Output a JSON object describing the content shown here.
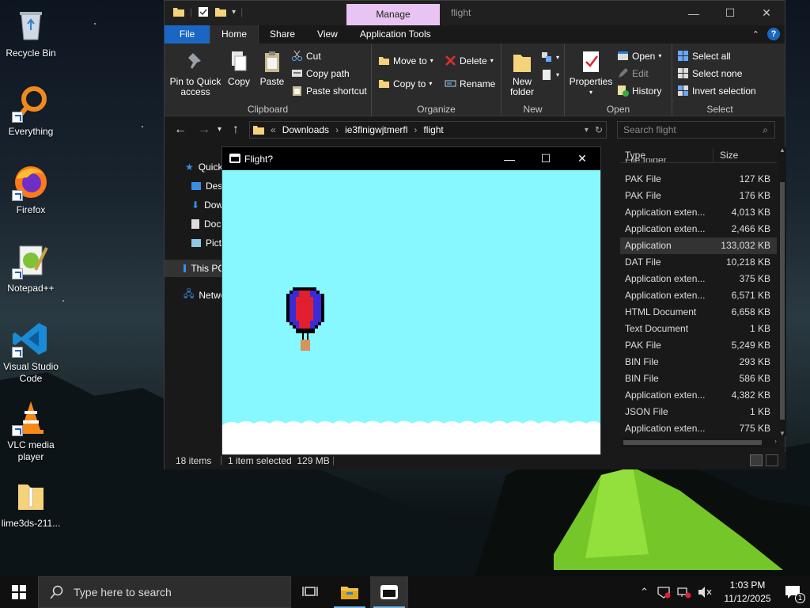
{
  "desktop": {
    "icons": [
      {
        "label": "Recycle Bin"
      },
      {
        "label": "Everything"
      },
      {
        "label": "Firefox"
      },
      {
        "label": "Notepad++"
      },
      {
        "label": "Visual Studio Code"
      },
      {
        "label": "VLC media player"
      },
      {
        "label": "lime3ds-211..."
      }
    ]
  },
  "explorer": {
    "title": "flight",
    "manage_tab": "Manage",
    "ribbon_tabs": [
      "File",
      "Home",
      "Share",
      "View",
      "Application Tools"
    ],
    "clipboard": {
      "pin": "Pin to Quick access",
      "copy": "Copy",
      "paste": "Paste",
      "cut": "Cut",
      "copy_path": "Copy path",
      "paste_shortcut": "Paste shortcut",
      "label": "Clipboard"
    },
    "organize": {
      "move_to": "Move to",
      "copy_to": "Copy to",
      "delete": "Delete",
      "rename": "Rename",
      "label": "Organize"
    },
    "new": {
      "new_folder": "New folder",
      "label": "New"
    },
    "open": {
      "properties": "Properties",
      "open": "Open",
      "edit": "Edit",
      "history": "History",
      "label": "Open"
    },
    "select": {
      "select_all": "Select all",
      "select_none": "Select none",
      "invert": "Invert selection",
      "label": "Select"
    },
    "address": {
      "chevrons": "«",
      "crumbs": [
        "Downloads",
        "ie3flnigwjtmerfl",
        "flight"
      ]
    },
    "search": {
      "placeholder": "Search flight"
    },
    "nav": {
      "quick": "Quick access",
      "desktop": "Desktop",
      "downloads": "Downloads",
      "documents": "Documents",
      "pictures": "Pictures",
      "this_pc": "This PC",
      "network": "Network"
    },
    "columns": {
      "type": "Type",
      "size": "Size"
    },
    "partial_row": "File folder",
    "files": [
      {
        "type": "PAK File",
        "size": "127 KB"
      },
      {
        "type": "PAK File",
        "size": "176 KB"
      },
      {
        "type": "Application exten...",
        "size": "4,013 KB"
      },
      {
        "type": "Application exten...",
        "size": "2,466 KB"
      },
      {
        "type": "Application",
        "size": "133,032 KB"
      },
      {
        "type": "DAT File",
        "size": "10,218 KB"
      },
      {
        "type": "Application exten...",
        "size": "375 KB"
      },
      {
        "type": "Application exten...",
        "size": "6,571 KB"
      },
      {
        "type": "HTML Document",
        "size": "6,658 KB"
      },
      {
        "type": "Text Document",
        "size": "1 KB"
      },
      {
        "type": "PAK File",
        "size": "5,249 KB"
      },
      {
        "type": "BIN File",
        "size": "293 KB"
      },
      {
        "type": "BIN File",
        "size": "586 KB"
      },
      {
        "type": "Application exten...",
        "size": "4,382 KB"
      },
      {
        "type": "JSON File",
        "size": "1 KB"
      },
      {
        "type": "Application exten...",
        "size": "775 KB"
      }
    ],
    "status": {
      "items": "18 items",
      "selected": "1 item selected  129 MB"
    }
  },
  "flight_window": {
    "title": "Flight?"
  },
  "taskbar": {
    "search_placeholder": "Type here to search",
    "time": "1:03 PM",
    "date": "11/12/2025",
    "notification_count": "1"
  },
  "colors": {
    "sky": "#87f8ff",
    "accent": "#1a66c2",
    "manage_tab": "#e7c4f2"
  }
}
